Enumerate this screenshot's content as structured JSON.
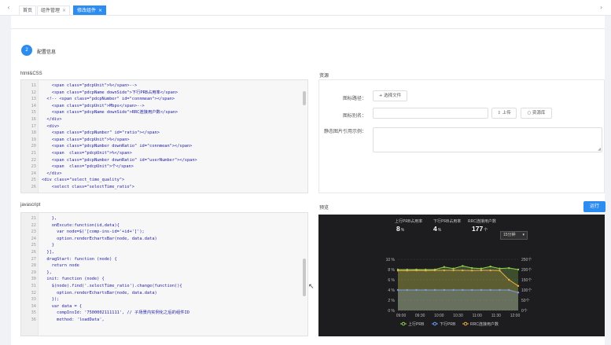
{
  "tabs": [
    {
      "label": "首页",
      "closable": false,
      "active": false
    },
    {
      "label": "组件管理",
      "closable": true,
      "active": false
    },
    {
      "label": "修改组件",
      "closable": true,
      "active": true
    }
  ],
  "close_glyph": "×",
  "nav": {
    "prev": "‹",
    "next": "›"
  },
  "step": {
    "number": "2",
    "title": "配置信息"
  },
  "sections": {
    "html_css": "html&CSS",
    "resources": "资源",
    "javascript": "javascript",
    "preview": "预览"
  },
  "html_code": [
    {
      "n": "11",
      "text": "    <span class=\"pdcpUnit\">%</span>-->"
    },
    {
      "n": "12",
      "text": "    <span class=\"pdcpName downSide\">下行PRB占用率</span>"
    },
    {
      "n": "13",
      "text": "  <!-- <span class=\"pdcpNumber\" id=\"connmean\"></span>"
    },
    {
      "n": "14",
      "text": "    <span class=\"pdcpUnit\">Mbps</span>-->"
    },
    {
      "n": "15",
      "text": "    <span class=\"pdcpName downSide\">RRC连接用户数</span>"
    },
    {
      "n": "16",
      "text": "  </div>"
    },
    {
      "n": "17",
      "text": "  <div>"
    },
    {
      "n": "18",
      "text": "    <span class=\"pdcpNumber\" id=\"ratio\"></span>"
    },
    {
      "n": "19",
      "text": "    <span class=\"pdcpUnit\">%</span>"
    },
    {
      "n": "20",
      "text": "    <span class=\"pdcpNumber downRatio\" id=\"connmean\"></span>"
    },
    {
      "n": "21",
      "text": "    <span  class=\"pdcpUnit\">%</span>"
    },
    {
      "n": "22",
      "text": "    <span class=\"pdcpNumber downRatio\" id=\"userNumber\"></span>"
    },
    {
      "n": "23",
      "text": "    <span  class=\"pdcpUnit\">个</span>"
    },
    {
      "n": "24",
      "text": "  </div>"
    },
    {
      "n": "25",
      "text": "<div class=\"select_time_quality\">"
    },
    {
      "n": "26",
      "text": "    <select class=\"selectTime_ratio\">"
    }
  ],
  "js_code": [
    {
      "n": "21",
      "text": "    },"
    },
    {
      "n": "22",
      "text": "    onExcute:function(id,data){"
    },
    {
      "n": "23",
      "text": "      var node=$('[comp-ins-id='+id+']');"
    },
    {
      "n": "24",
      "text": "      option.renderEchartsBar(node, data.data)"
    },
    {
      "n": "25",
      "text": "    }"
    },
    {
      "n": "26",
      "text": "  }],"
    },
    {
      "n": "27",
      "text": "  dragStart: function (node) {"
    },
    {
      "n": "28",
      "text": "    return node"
    },
    {
      "n": "29",
      "text": "  },"
    },
    {
      "n": "30",
      "text": "  init: function (node) {"
    },
    {
      "n": "31",
      "text": "    $(node).find('.selectTime_ratio').change(function(){"
    },
    {
      "n": "32",
      "text": "      option.renderEchartsBar(node, data.data)"
    },
    {
      "n": "33",
      "text": "    });"
    },
    {
      "n": "34",
      "text": "    var data = {"
    },
    {
      "n": "35",
      "text": "      compInsId: '7500002111111', // 子场景内实例化之后的组件ID"
    },
    {
      "n": "36",
      "text": "      method: 'loadData',"
    }
  ],
  "resource_form": {
    "path_label": "图标路径：",
    "choose_file": "选择文件",
    "alias_label": "图标别名：",
    "upload": "上传",
    "browse": "资源库",
    "static_label": "静态图片引用示例："
  },
  "run_label": "运行",
  "icons": {
    "plus": "plus-icon",
    "upload": "upload-icon",
    "search": "search-icon",
    "resize": "resize-handle-icon",
    "cursor": "mouse-cursor-icon"
  },
  "stats": [
    {
      "label": "上行PRB占用率",
      "value": "8",
      "unit": "%"
    },
    {
      "label": "下行PRB占用率",
      "value": "4",
      "unit": "%"
    },
    {
      "label": "RRC连接用户数",
      "value": "177",
      "unit": "个"
    }
  ],
  "time_select": "15分钟",
  "colors": {
    "accent": "#2d8cf0",
    "uplink": "#8fd14f",
    "downlink": "#6b9cf2",
    "rrc": "#f1ad47"
  },
  "chart_data": {
    "type": "line",
    "x": [
      "09:00",
      "09:30",
      "10:00",
      "10:30",
      "11:00",
      "11:30",
      "12:00"
    ],
    "points_x": [
      "09:00",
      "09:15",
      "09:30",
      "09:45",
      "10:00",
      "10:15",
      "10:30",
      "10:45",
      "11:00",
      "11:15",
      "11:30",
      "11:45",
      "12:00",
      "12:15"
    ],
    "y_left_ticks": [
      "10 %",
      "8 %",
      "6 %",
      "4 %",
      "2 %",
      "0 %"
    ],
    "y_right_ticks": [
      "250个",
      "200个",
      "150个",
      "100个",
      "50个",
      "0个"
    ],
    "ylim_left": [
      0,
      10
    ],
    "ylim_right": [
      0,
      250
    ],
    "series": [
      {
        "name": "上行PRB",
        "axis": "left",
        "color": "#8fd14f",
        "values": [
          8,
          8,
          8,
          8,
          8,
          8.5,
          8.2,
          8.7,
          8.3,
          8.2,
          8.6,
          8.2,
          8.3,
          8
        ]
      },
      {
        "name": "下行PRB",
        "axis": "left",
        "color": "#6b9cf2",
        "values": [
          4,
          4,
          4,
          4,
          4,
          4,
          4,
          4,
          4,
          4,
          4,
          4,
          4,
          3.5
        ]
      },
      {
        "name": "RRC连接用户数",
        "axis": "right",
        "color": "#f1ad47",
        "values": [
          195,
          195,
          196,
          195,
          196,
          196,
          196,
          196,
          195,
          196,
          196,
          195,
          150,
          120
        ]
      }
    ],
    "legend_position": "bottom",
    "grid": true
  }
}
